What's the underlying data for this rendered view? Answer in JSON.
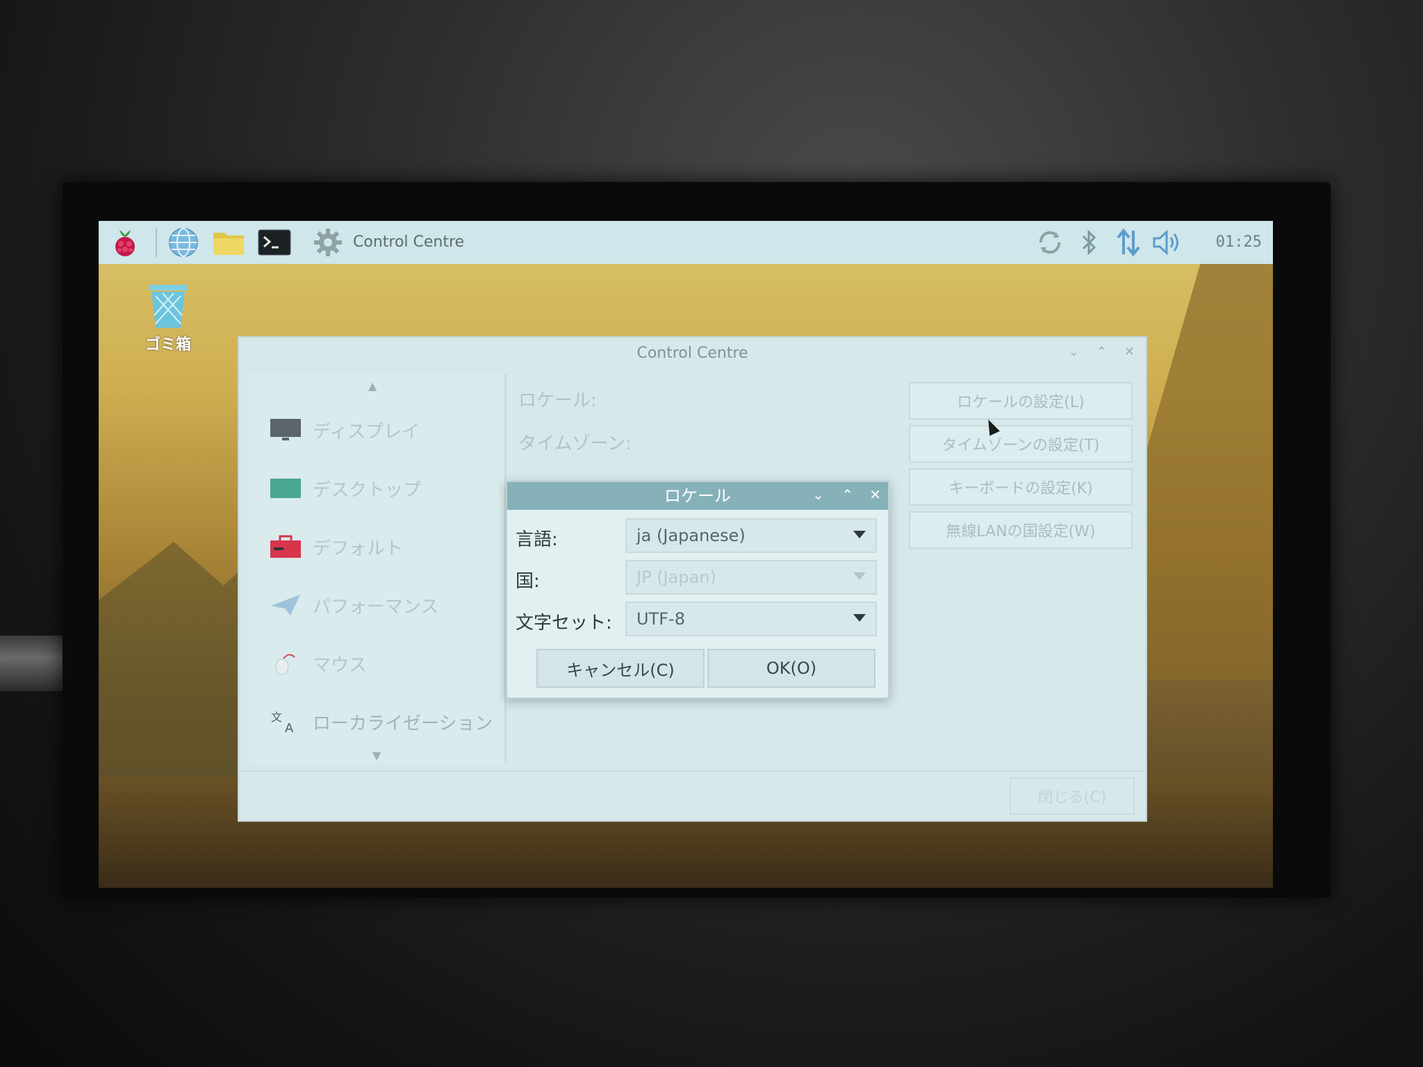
{
  "taskbar": {
    "app_title": "Control Centre",
    "clock": "01:25",
    "icons": [
      "raspberry-menu-icon",
      "web-browser-icon",
      "file-manager-icon",
      "terminal-icon",
      "settings-gear-icon",
      "updater-icon",
      "bluetooth-icon",
      "network-icon",
      "volume-icon"
    ]
  },
  "desktop": {
    "trash_label": "ゴミ箱"
  },
  "control_centre": {
    "title": "Control Centre",
    "sidebar": {
      "items": [
        {
          "label": "ディスプレイ",
          "icon": "display-icon"
        },
        {
          "label": "デスクトップ",
          "icon": "desktop-icon"
        },
        {
          "label": "デフォルト",
          "icon": "defaults-toolbox-icon"
        },
        {
          "label": "パフォーマンス",
          "icon": "performance-icon"
        },
        {
          "label": "マウス",
          "icon": "mouse-icon"
        },
        {
          "label": "ローカライゼーション",
          "icon": "localisation-icon"
        }
      ]
    },
    "labels": {
      "locale": "ロケール:",
      "timezone": "タイムゾーン:"
    },
    "buttons": {
      "locale": "ロケールの設定(L)",
      "timezone": "タイムゾーンの設定(T)",
      "keyboard": "キーボードの設定(K)",
      "wifi_country": "無線LANの国設定(W)",
      "close": "閉じる(C)"
    }
  },
  "locale_dialog": {
    "title": "ロケール",
    "language_label": "言語:",
    "language_value": "ja (Japanese)",
    "country_label": "国:",
    "country_value": "JP (Japan)",
    "charset_label": "文字セット:",
    "charset_value": "UTF-8",
    "cancel": "キャンセル(C)",
    "ok": "OK(O)"
  }
}
